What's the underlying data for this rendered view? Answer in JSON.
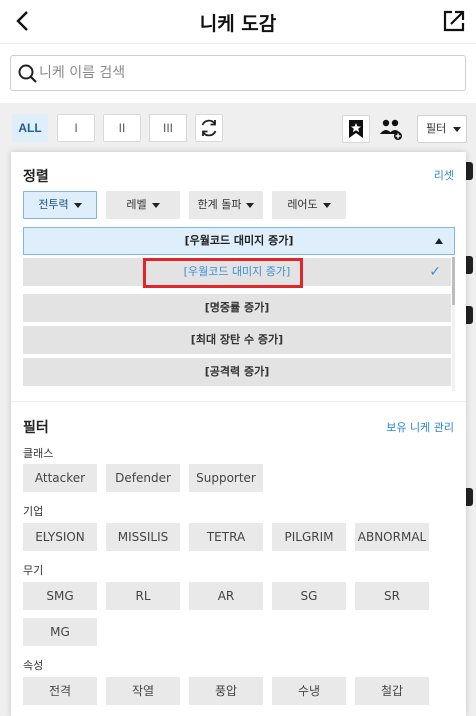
{
  "header": {
    "title": "니케 도감"
  },
  "search": {
    "placeholder": "니케 이름 검색"
  },
  "toolbar": {
    "tiers": [
      "ALL",
      "I",
      "II",
      "III"
    ],
    "filter_label": "필터"
  },
  "panel": {
    "sort": {
      "title": "정렬",
      "reset_label": "리셋",
      "options": [
        "전투력",
        "레벨",
        "한계 돌파",
        "레어도"
      ],
      "current": "[우월코드 대미지 증가]",
      "list": [
        "[우월코드 대미지 증가]",
        "[명중률 증가]",
        "[최대 장탄 수 증가]",
        "[공격력 증가]"
      ]
    },
    "filter": {
      "title": "필터",
      "manage_label": "보유 니케 관리",
      "class_label": "클래스",
      "classes": [
        "Attacker",
        "Defender",
        "Supporter"
      ],
      "company_label": "기업",
      "companies": [
        "ELYSION",
        "MISSILIS",
        "TETRA",
        "PILGRIM",
        "ABNORMAL"
      ],
      "weapon_label": "무기",
      "weapons": [
        "SMG",
        "RL",
        "AR",
        "SG",
        "SR",
        "MG"
      ],
      "element_label": "속성",
      "elements": [
        "전격",
        "작열",
        "풍압",
        "수냉",
        "철갑"
      ]
    }
  },
  "colors": {
    "accent": "#2a86d6",
    "highlight": "#e0262a",
    "selected_bg": "#dfeefb"
  }
}
